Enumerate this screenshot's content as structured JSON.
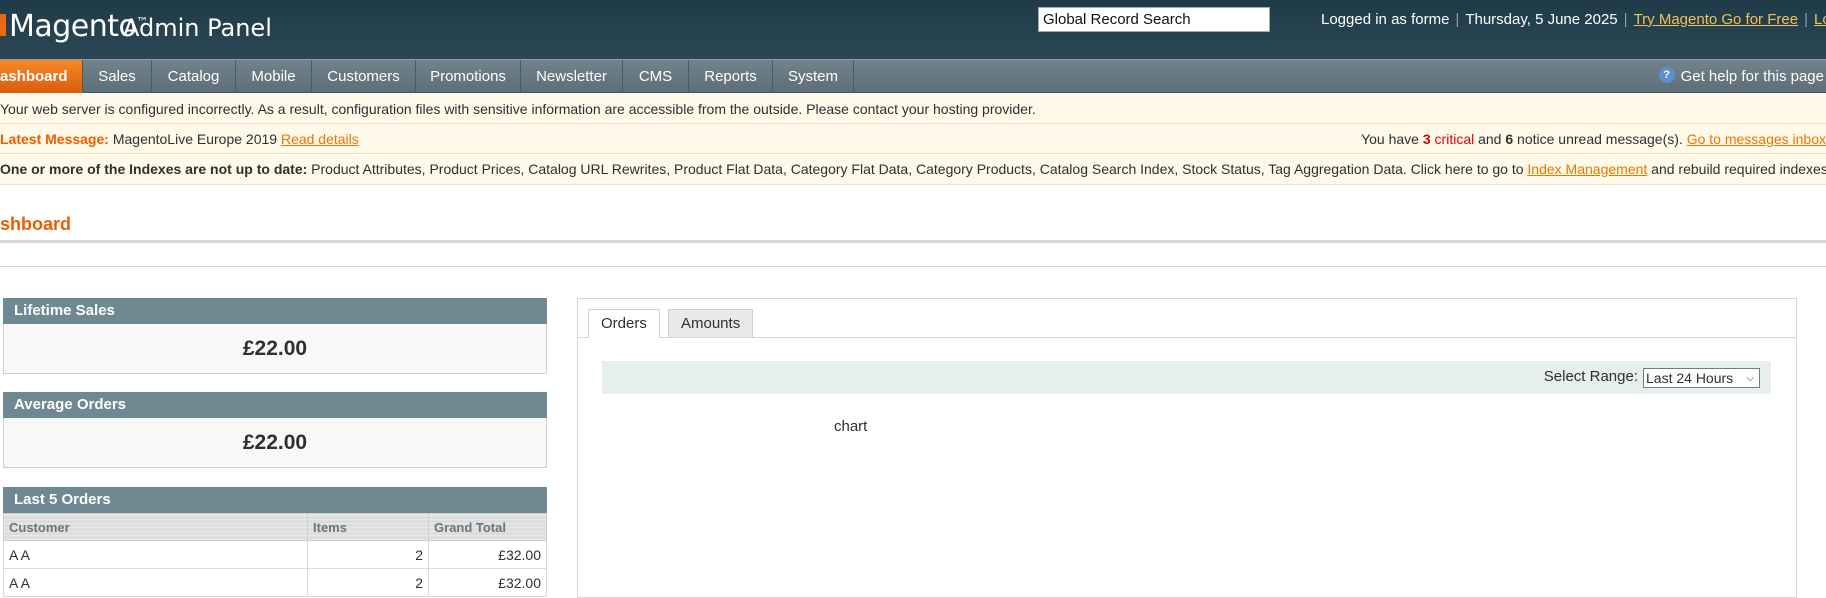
{
  "header": {
    "logo_name": "Magento",
    "logo_tm": "™",
    "logo_sub": "Admin Panel",
    "search_value": "Global Record Search",
    "logged_in": "Logged in as forme",
    "date": "Thursday, 5 June 2025",
    "try_link": "Try Magento Go for Free",
    "logout_link": "Log Out"
  },
  "nav": {
    "items": [
      "ashboard",
      "Sales",
      "Catalog",
      "Mobile",
      "Customers",
      "Promotions",
      "Newsletter",
      "CMS",
      "Reports",
      "System"
    ],
    "active": "ashboard",
    "help": "Get help for this page"
  },
  "notices": {
    "server": "Your web server is configured incorrectly. As a result, configuration files with sensitive information are accessible from the outside. Please contact your hosting provider.",
    "latest_label": "Latest Message:",
    "latest_text": "MagentoLive Europe 2019",
    "latest_link": "Read details",
    "msgs_prefix": "You have",
    "critical_count": "3",
    "critical_word": "critical",
    "and_word": "and",
    "notice_count": "6",
    "msgs_suffix": "notice unread message(s).",
    "msgs_link": "Go to messages inbox",
    "index_label": "One or more of the Indexes are not up to date:",
    "index_text": "Product Attributes, Product Prices, Catalog URL Rewrites, Product Flat Data, Category Flat Data, Category Products, Catalog Search Index, Stock Status, Tag Aggregation Data. Click here to go to",
    "index_link": "Index Management",
    "index_suffix": "and rebuild required indexes."
  },
  "page": {
    "title": "shboard"
  },
  "lifetime_sales": {
    "label": "Lifetime Sales",
    "value": "£22.00"
  },
  "average_orders": {
    "label": "Average Orders",
    "value": "£22.00"
  },
  "last_orders": {
    "label": "Last 5 Orders",
    "columns": [
      "Customer",
      "Items",
      "Grand Total"
    ],
    "rows": [
      {
        "customer": "A A",
        "items": "2",
        "total": "£32.00"
      },
      {
        "customer": "A A",
        "items": "2",
        "total": "£32.00"
      }
    ]
  },
  "chart_panel": {
    "tabs": [
      "Orders",
      "Amounts"
    ],
    "active_tab": "Orders",
    "range_label": "Select Range:",
    "range_value": "Last 24 Hours",
    "chart_placeholder": "chart"
  },
  "colors": {
    "accent": "#eb5e00",
    "header_bg": "#1f3b47",
    "nav_bg": "#687a83",
    "box_head": "#6f8992"
  }
}
